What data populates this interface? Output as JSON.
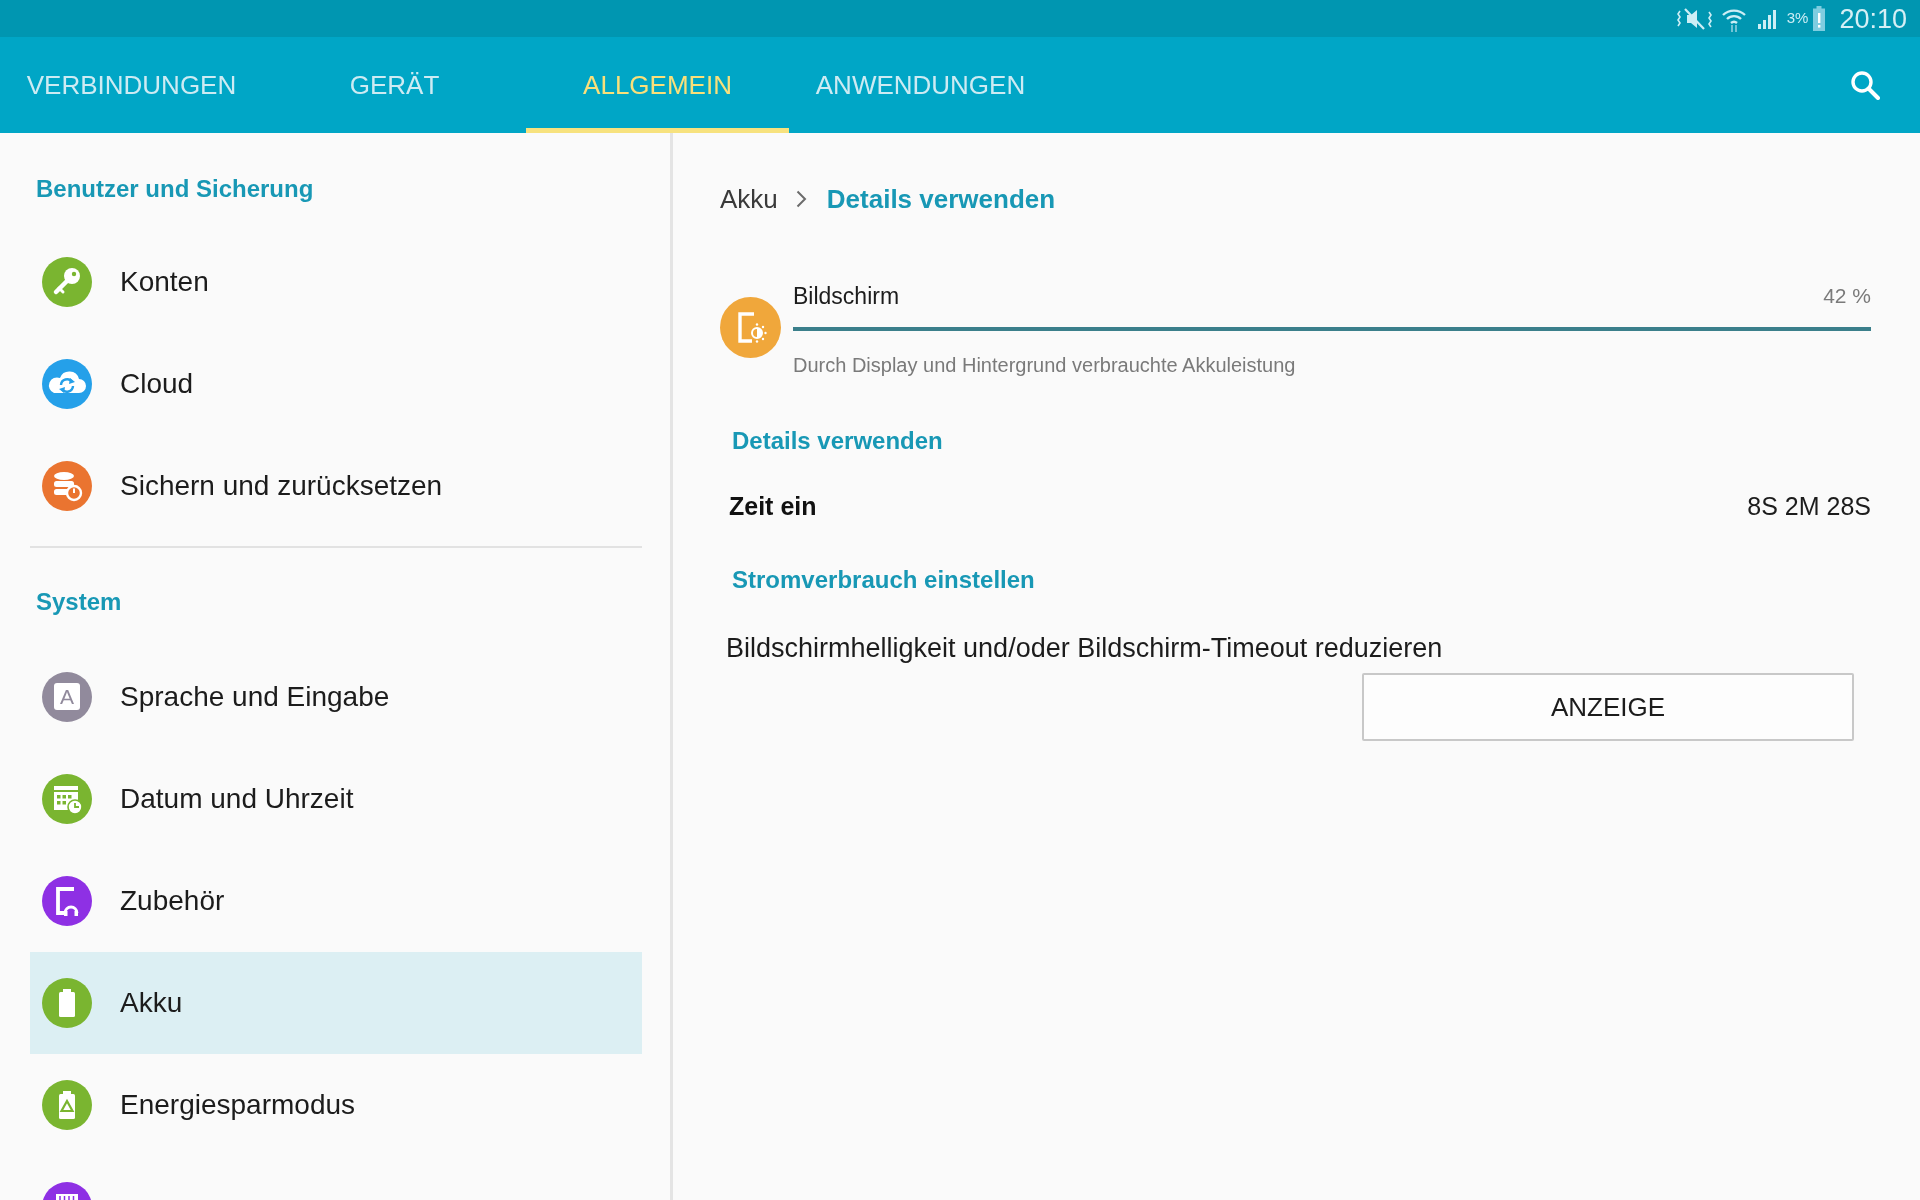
{
  "status_bar": {
    "battery_percent": "3%",
    "time": "20:10"
  },
  "tabs": [
    {
      "label": "VERBINDUNGEN",
      "selected": false
    },
    {
      "label": "GERÄT",
      "selected": false
    },
    {
      "label": "ALLGEMEIN",
      "selected": true
    },
    {
      "label": "ANWENDUNGEN",
      "selected": false
    }
  ],
  "sidebar": {
    "sections": [
      {
        "title": "Benutzer und Sicherung",
        "items": [
          {
            "label": "Konten",
            "color": "#7ab530",
            "selected": false
          },
          {
            "label": "Cloud",
            "color": "#25a0e9",
            "selected": false
          },
          {
            "label": "Sichern und zurücksetzen",
            "color": "#ea7430",
            "selected": false
          }
        ]
      },
      {
        "title": "System",
        "items": [
          {
            "label": "Sprache und Eingabe",
            "icon_letter": "A",
            "color": "#918a9c",
            "selected": false
          },
          {
            "label": "Datum und Uhrzeit",
            "color": "#7ab530",
            "selected": false
          },
          {
            "label": "Zubehör",
            "color": "#8e30e4",
            "selected": false
          },
          {
            "label": "Akku",
            "color": "#7ab530",
            "selected": true
          },
          {
            "label": "Energiesparmodus",
            "color": "#7ab530",
            "selected": false
          },
          {
            "color": "#8e30e4",
            "selected": false
          }
        ]
      }
    ]
  },
  "detail": {
    "breadcrumb": [
      "Akku",
      "Details verwenden"
    ],
    "usage": {
      "name": "Bildschirm",
      "percent": "42 %",
      "level": 1,
      "description": "Durch Display und Hintergrund verbrauchte Akkuleistung"
    },
    "usage_details": {
      "title": "Details verwenden",
      "rows": [
        {
          "label": "Zeit ein",
          "value": "8S 2M 28S"
        }
      ]
    },
    "power_settings": {
      "title": "Stromverbrauch einstellen",
      "tip": "Bildschirmhelligkeit und/oder Bildschirm-Timeout reduzieren",
      "button": "ANZEIGE"
    }
  }
}
